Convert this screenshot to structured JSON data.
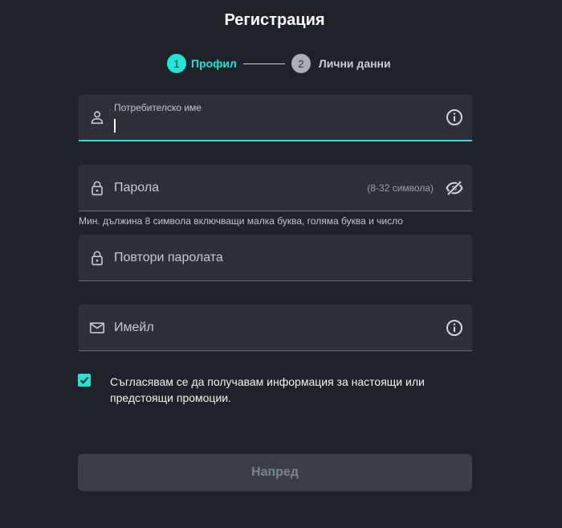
{
  "page": {
    "title": "Регистрация"
  },
  "stepper": {
    "steps": [
      {
        "number": "1",
        "label": "Профил",
        "state": "active"
      },
      {
        "number": "2",
        "label": "Лични данни",
        "state": "inactive"
      }
    ]
  },
  "form": {
    "username": {
      "label": "Потребителско име",
      "value": "",
      "icon": "person-icon",
      "trailing_icon": "info-icon"
    },
    "password": {
      "label": "Парола",
      "hint": "(8-32 символа)",
      "icon": "lock-icon",
      "trailing_icon": "eye-off-icon"
    },
    "password_helper": "Мин. дължина 8 символа включващи малка буква, голяма буква и число",
    "repeat_password": {
      "label": "Повтори паролата",
      "icon": "lock-icon"
    },
    "email": {
      "label": "Имейл",
      "icon": "mail-icon",
      "trailing_icon": "info-icon"
    },
    "consent": {
      "checked": true,
      "text": "Съгласявам се да получавам информация за настоящи или предстоящи промоции."
    },
    "submit_label": "Напред"
  },
  "colors": {
    "accent": "#23e2d6",
    "background": "#1f2329",
    "field": "#2c3038"
  }
}
